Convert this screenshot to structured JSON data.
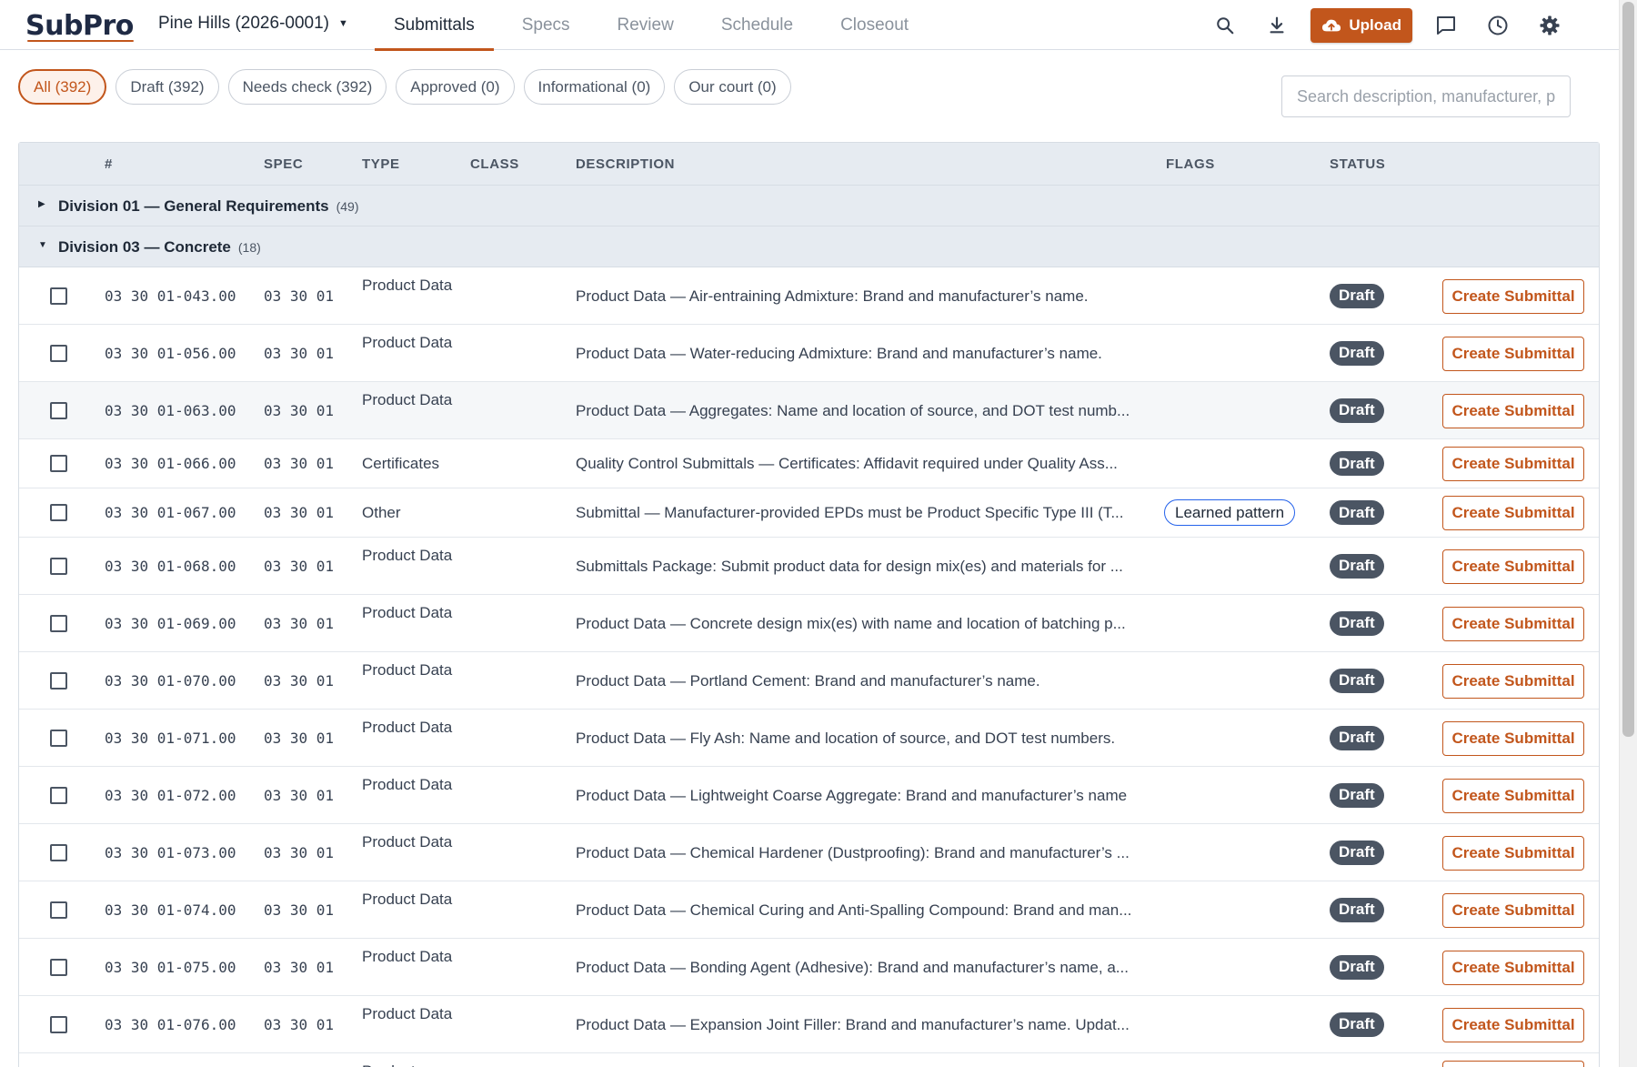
{
  "header": {
    "logo_sub": "Sub",
    "logo_pro": "Pro",
    "project": "Pine Hills (2026-0001)",
    "tabs": [
      "Submittals",
      "Specs",
      "Review",
      "Schedule",
      "Closeout"
    ],
    "active_tab": "Submittals",
    "upload_label": "Upload",
    "icons": [
      "search-icon",
      "download-icon",
      "upload-cloud-icon",
      "comment-icon",
      "clock-icon",
      "gear-icon"
    ]
  },
  "filters": [
    {
      "label": "All (392)",
      "active": true
    },
    {
      "label": "Draft (392)",
      "active": false
    },
    {
      "label": "Needs check (392)",
      "active": false
    },
    {
      "label": "Approved (0)",
      "active": false
    },
    {
      "label": "Informational (0)",
      "active": false
    },
    {
      "label": "Our court (0)",
      "active": false
    }
  ],
  "search": {
    "placeholder": "Search description, manufacturer, pro"
  },
  "table": {
    "columns": [
      "#",
      "SPEC",
      "TYPE",
      "CLASS",
      "DESCRIPTION",
      "FLAGS",
      "STATUS"
    ],
    "groups": [
      {
        "name": "Division 01 — General Requirements",
        "count": "(49)",
        "expanded": false
      },
      {
        "name": "Division 03 — Concrete",
        "count": "(18)",
        "expanded": true
      }
    ],
    "action_label": "Create Submittal",
    "rows": [
      {
        "num": "03 30 01-043.00",
        "spec": "03 30 01",
        "type": "Product Data",
        "desc": "Product Data — Air-entraining Admixture: Brand and manufacturer’s name.",
        "flag": "",
        "status": "Draft"
      },
      {
        "num": "03 30 01-056.00",
        "spec": "03 30 01",
        "type": "Product Data",
        "desc": "Product Data — Water-reducing Admixture: Brand and manufacturer’s name.",
        "flag": "",
        "status": "Draft"
      },
      {
        "num": "03 30 01-063.00",
        "spec": "03 30 01",
        "type": "Product Data",
        "desc": "Product Data — Aggregates: Name and location of source, and DOT test numb...",
        "flag": "",
        "status": "Draft"
      },
      {
        "num": "03 30 01-066.00",
        "spec": "03 30 01",
        "type": "Certificates",
        "desc": "Quality Control Submittals — Certificates: Affidavit required under Quality Ass...",
        "flag": "",
        "status": "Draft"
      },
      {
        "num": "03 30 01-067.00",
        "spec": "03 30 01",
        "type": "Other",
        "desc": "Submittal — Manufacturer-provided EPDs must be Product Specific Type III (T...",
        "flag": "Learned pattern",
        "status": "Draft"
      },
      {
        "num": "03 30 01-068.00",
        "spec": "03 30 01",
        "type": "Product Data",
        "desc": "Submittals Package: Submit product data for design mix(es) and materials for ...",
        "flag": "",
        "status": "Draft"
      },
      {
        "num": "03 30 01-069.00",
        "spec": "03 30 01",
        "type": "Product Data",
        "desc": "Product Data — Concrete design mix(es) with name and location of batching p...",
        "flag": "",
        "status": "Draft"
      },
      {
        "num": "03 30 01-070.00",
        "spec": "03 30 01",
        "type": "Product Data",
        "desc": "Product Data — Portland Cement: Brand and manufacturer’s name.",
        "flag": "",
        "status": "Draft"
      },
      {
        "num": "03 30 01-071.00",
        "spec": "03 30 01",
        "type": "Product Data",
        "desc": "Product Data — Fly Ash: Name and location of source, and DOT test numbers.",
        "flag": "",
        "status": "Draft"
      },
      {
        "num": "03 30 01-072.00",
        "spec": "03 30 01",
        "type": "Product Data",
        "desc": "Product Data — Lightweight Coarse Aggregate: Brand and manufacturer’s name",
        "flag": "",
        "status": "Draft"
      },
      {
        "num": "03 30 01-073.00",
        "spec": "03 30 01",
        "type": "Product Data",
        "desc": "Product Data — Chemical Hardener (Dustproofing): Brand and manufacturer’s ...",
        "flag": "",
        "status": "Draft"
      },
      {
        "num": "03 30 01-074.00",
        "spec": "03 30 01",
        "type": "Product Data",
        "desc": "Product Data — Chemical Curing and Anti-Spalling Compound: Brand and man...",
        "flag": "",
        "status": "Draft"
      },
      {
        "num": "03 30 01-075.00",
        "spec": "03 30 01",
        "type": "Product Data",
        "desc": "Product Data — Bonding Agent (Adhesive): Brand and manufacturer’s name, a...",
        "flag": "",
        "status": "Draft"
      },
      {
        "num": "03 30 01-076.00",
        "spec": "03 30 01",
        "type": "Product Data",
        "desc": "Product Data — Expansion Joint Filler: Brand and manufacturer’s name. Updat...",
        "flag": "",
        "status": "Draft"
      },
      {
        "num": "",
        "spec": "",
        "type": "Product",
        "desc": "",
        "flag": "",
        "status": ""
      }
    ]
  },
  "colors": {
    "accent": "#c2561c",
    "badge": "#4b5563",
    "flag_border": "#2563eb",
    "header_bg": "#e6ebf1"
  }
}
